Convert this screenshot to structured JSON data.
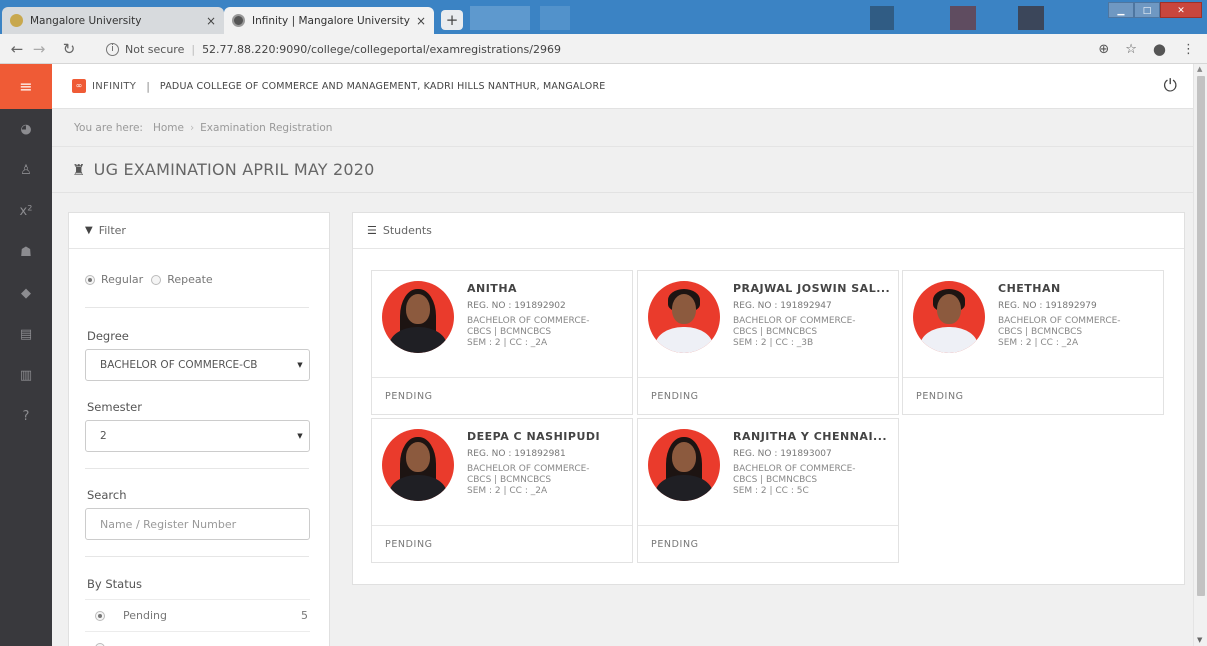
{
  "browser": {
    "tabs": [
      {
        "title": "Mangalore University",
        "close": "×"
      },
      {
        "title": "Infinity | Mangalore University",
        "close": "×"
      }
    ],
    "new_tab": "+",
    "address": {
      "security": "Not secure",
      "url": "52.77.88.220:9090/college/collegeportal/examregistrations/2969"
    }
  },
  "app": {
    "brand": "INFINITY",
    "brand_sep": "|",
    "college": "PADUA COLLEGE OF COMMERCE AND MANAGEMENT, KADRI HILLS NANTHUR, MANGALORE"
  },
  "breadcrumb": {
    "prefix": "You are here:",
    "home": "Home",
    "current": "Examination Registration"
  },
  "page": {
    "title": "UG EXAMINATION APRIL MAY 2020"
  },
  "filter": {
    "heading": "Filter",
    "mode_options": [
      "Regular",
      "Repeate"
    ],
    "mode_selected": "Regular",
    "degree_label": "Degree",
    "degree_value": "BACHELOR OF COMMERCE-CB",
    "semester_label": "Semester",
    "semester_value": "2",
    "search_label": "Search",
    "search_placeholder": "Name / Register Number",
    "status_label": "By Status",
    "statuses": [
      {
        "label": "Pending",
        "count": "5"
      }
    ]
  },
  "students": {
    "heading": "Students",
    "cards": [
      {
        "name": "ANITHA",
        "reg": "REG. NO : 191892902",
        "degree_line1": "BACHELOR OF COMMERCE-",
        "degree_line2": "CBCS | BCMNCBCS",
        "sem": "SEM : 2 | CC : _2A",
        "status": "PENDING"
      },
      {
        "name": "PRAJWAL JOSWIN SAL...",
        "reg": "REG. NO : 191892947",
        "degree_line1": "BACHELOR OF COMMERCE-",
        "degree_line2": "CBCS | BCMNCBCS",
        "sem": "SEM : 2 | CC : _3B",
        "status": "PENDING"
      },
      {
        "name": "CHETHAN",
        "reg": "REG. NO : 191892979",
        "degree_line1": "BACHELOR OF COMMERCE-",
        "degree_line2": "CBCS | BCMNCBCS",
        "sem": "SEM : 2 | CC : _2A",
        "status": "PENDING"
      },
      {
        "name": "DEEPA C NASHIPUDI",
        "reg": "REG. NO : 191892981",
        "degree_line1": "BACHELOR OF COMMERCE-",
        "degree_line2": "CBCS | BCMNCBCS",
        "sem": "SEM : 2 | CC : _2A",
        "status": "PENDING"
      },
      {
        "name": "RANJITHA Y CHENNAI...",
        "reg": "REG. NO : 191893007",
        "degree_line1": "BACHELOR OF COMMERCE-",
        "degree_line2": "CBCS | BCMNCBCS",
        "sem": "SEM : 2 | CC : 5C",
        "status": "PENDING"
      }
    ]
  },
  "colors": {
    "accent": "#ef5b36",
    "sidebar": "#39393d",
    "avatar_bg": "#ea3b2c"
  }
}
